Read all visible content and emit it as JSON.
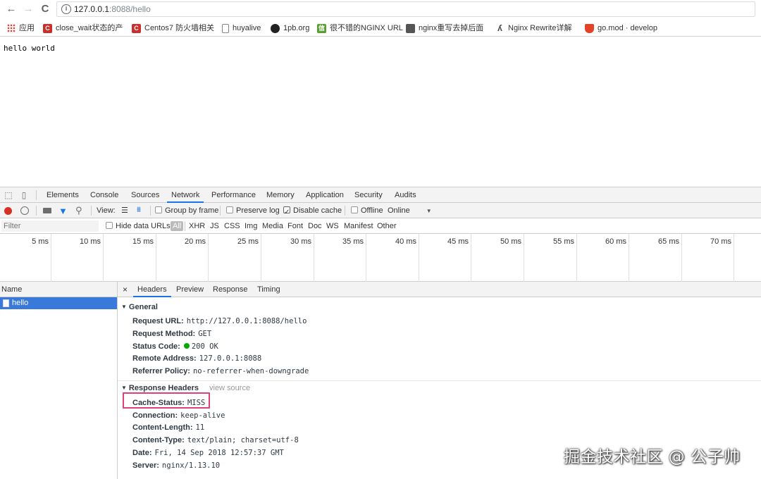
{
  "browser": {
    "url_host": "127.0.0.1",
    "url_path": ":8088/hello",
    "nav": {
      "back": "←",
      "forward": "→",
      "reload": "C"
    },
    "info_icon": "i"
  },
  "bookmarks": [
    {
      "label": "应用",
      "icon": "apps-grid-icon",
      "color": "#e34133"
    },
    {
      "label": "close_wait状态的产",
      "icon": "csdn-icon",
      "color": "#c9302c"
    },
    {
      "label": "Centos7 防火墙相关",
      "icon": "csdn-icon",
      "color": "#c9302c"
    },
    {
      "label": "huyalive",
      "icon": "document-icon",
      "color": "#888888"
    },
    {
      "label": "1pb.org",
      "icon": "github-icon",
      "color": "#222222"
    },
    {
      "label": "很不错的NGINX URL",
      "icon": "site-icon",
      "color": "#5a9e2f"
    },
    {
      "label": "nginx重写去掉后面",
      "icon": "site-icon",
      "color": "#555555"
    },
    {
      "label": "Nginx Rewrite详解",
      "icon": "site-icon",
      "color": "#444444"
    },
    {
      "label": "go.mod · develop",
      "icon": "gitlab-icon",
      "color": "#e24329"
    }
  ],
  "page": {
    "text": "hello world"
  },
  "devtools": {
    "tabs": [
      "Elements",
      "Console",
      "Sources",
      "Network",
      "Performance",
      "Memory",
      "Application",
      "Security",
      "Audits"
    ],
    "active_tab": "Network",
    "toolbar": {
      "view_label": "View:",
      "group_by_frame": "Group by frame",
      "preserve_log": "Preserve log",
      "disable_cache": "Disable cache",
      "offline": "Offline",
      "throttle": "Online"
    },
    "filter": {
      "placeholder": "Filter",
      "hide_data_urls": "Hide data URLs",
      "all": "All",
      "types": [
        "XHR",
        "JS",
        "CSS",
        "Img",
        "Media",
        "Font",
        "Doc",
        "WS",
        "Manifest",
        "Other"
      ]
    },
    "timeline_ticks": [
      "5 ms",
      "10 ms",
      "15 ms",
      "20 ms",
      "25 ms",
      "30 ms",
      "35 ms",
      "40 ms",
      "45 ms",
      "50 ms",
      "55 ms",
      "60 ms",
      "65 ms",
      "70 ms"
    ],
    "name_header": "Name",
    "request_name": "hello",
    "detail_tabs": {
      "close": "×",
      "tabs": [
        "Headers",
        "Preview",
        "Response",
        "Timing"
      ],
      "active": "Headers"
    },
    "general": {
      "title": "General",
      "rows": [
        {
          "k": "Request URL:",
          "v": "http://127.0.0.1:8088/hello"
        },
        {
          "k": "Request Method:",
          "v": "GET"
        },
        {
          "k": "Status Code:",
          "v": "200 OK"
        },
        {
          "k": "Remote Address:",
          "v": "127.0.0.1:8088"
        },
        {
          "k": "Referrer Policy:",
          "v": "no-referrer-when-downgrade"
        }
      ]
    },
    "response_headers": {
      "title": "Response Headers",
      "view_source": "view source",
      "rows": [
        {
          "k": "Cache-Status:",
          "v": "MISS"
        },
        {
          "k": "Connection:",
          "v": "keep-alive"
        },
        {
          "k": "Content-Length:",
          "v": "11"
        },
        {
          "k": "Content-Type:",
          "v": "text/plain; charset=utf-8"
        },
        {
          "k": "Date:",
          "v": "Fri, 14 Sep 2018 12:57:37 GMT"
        },
        {
          "k": "Server:",
          "v": "nginx/1.13.10"
        }
      ]
    },
    "colors": {
      "accent": "#1a73e8",
      "selected_row": "#3879d9",
      "status_ok": "#00aa00",
      "highlight_box": "#e0407a",
      "record": "#d93025"
    }
  },
  "watermark": "掘金技术社区 @ 公子帅"
}
